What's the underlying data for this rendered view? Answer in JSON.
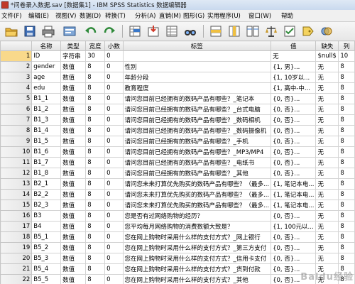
{
  "window": {
    "title": "*问卷录入数据.sav [数据集1] - IBM SPSS Statistics 数据编辑器"
  },
  "menu": [
    "文件(F)",
    "编辑(E)",
    "视图(V)",
    "数据(D)",
    "转换(T)",
    "分析(A)",
    "直销(M)",
    "图形(G)",
    "实用程序(U)",
    "窗口(W)",
    "帮助"
  ],
  "toolbar": {
    "icons": [
      "open-folder-icon",
      "save-icon",
      "print-icon",
      "dialog-recall-icon",
      "undo-icon",
      "redo-icon",
      "goto-case-icon",
      "goto-variable-icon",
      "variables-icon",
      "find-icon",
      "insert-cases-icon",
      "insert-variable-icon",
      "split-file-icon",
      "weight-cases-icon",
      "select-cases-icon",
      "value-labels-icon",
      "use-sets-icon"
    ]
  },
  "grid": {
    "headers": [
      "",
      "名称",
      "类型",
      "宽度",
      "小数",
      "标签",
      "值",
      "缺失",
      "列"
    ],
    "rows": [
      {
        "n": "1",
        "name": "ID",
        "type": "字符串",
        "width": "30",
        "dec": "0",
        "label": "",
        "values": "无",
        "missing": "$null$",
        "cols": "10"
      },
      {
        "n": "2",
        "name": "gender",
        "type": "数值",
        "width": "8",
        "dec": "0",
        "label": "性别",
        "values": "{1, 男}...",
        "missing": "无",
        "cols": "8"
      },
      {
        "n": "3",
        "name": "age",
        "type": "数值",
        "width": "8",
        "dec": "0",
        "label": "年龄分段",
        "values": "{1, 10岁以...",
        "missing": "无",
        "cols": "8"
      },
      {
        "n": "4",
        "name": "edu",
        "type": "数值",
        "width": "8",
        "dec": "0",
        "label": "教育程度",
        "values": "{1, 高中-中...",
        "missing": "无",
        "cols": "8"
      },
      {
        "n": "5",
        "name": "B1_1",
        "type": "数值",
        "width": "8",
        "dec": "0",
        "label": "请问您目前已经拥有的数码产品有哪些？_笔记本",
        "values": "{0, 否}...",
        "missing": "无",
        "cols": "8"
      },
      {
        "n": "6",
        "name": "B1_2",
        "type": "数值",
        "width": "8",
        "dec": "0",
        "label": "请问您目前已经拥有的数码产品有哪些？_台式电脑",
        "values": "{0, 否}...",
        "missing": "无",
        "cols": "8"
      },
      {
        "n": "7",
        "name": "B1_3",
        "type": "数值",
        "width": "8",
        "dec": "0",
        "label": "请问您目前已经拥有的数码产品有哪些？_数码相机",
        "values": "{0, 否}...",
        "missing": "无",
        "cols": "8"
      },
      {
        "n": "8",
        "name": "B1_4",
        "type": "数值",
        "width": "8",
        "dec": "0",
        "label": "请问您目前已经拥有的数码产品有哪些？_数码摄像机",
        "values": "{0, 否}...",
        "missing": "无",
        "cols": "8"
      },
      {
        "n": "9",
        "name": "B1_5",
        "type": "数值",
        "width": "8",
        "dec": "0",
        "label": "请问您目前已经拥有的数码产品有哪些？_手机",
        "values": "{0, 否}...",
        "missing": "无",
        "cols": "8"
      },
      {
        "n": "10",
        "name": "B1_6",
        "type": "数值",
        "width": "8",
        "dec": "0",
        "label": "请问您目前已经拥有的数码产品有哪些？_MP3/MP4",
        "values": "{0, 否}...",
        "missing": "无",
        "cols": "8"
      },
      {
        "n": "11",
        "name": "B1_7",
        "type": "数值",
        "width": "8",
        "dec": "0",
        "label": "请问您目前已经拥有的数码产品有哪些？_电纸书",
        "values": "{0, 否}...",
        "missing": "无",
        "cols": "8"
      },
      {
        "n": "12",
        "name": "B1_8",
        "type": "数值",
        "width": "8",
        "dec": "0",
        "label": "请问您目前已经拥有的数码产品有哪些？_其他",
        "values": "{0, 否}...",
        "missing": "无",
        "cols": "8"
      },
      {
        "n": "13",
        "name": "B2_1",
        "type": "数值",
        "width": "8",
        "dec": "0",
        "label": "请问您未来打算优先购买的数码产品有哪些？（最多...",
        "values": "{1, 笔记本电...",
        "missing": "无",
        "cols": "8"
      },
      {
        "n": "14",
        "name": "B2_2",
        "type": "数值",
        "width": "8",
        "dec": "0",
        "label": "请问您未来打算优先购买的数码产品有哪些？（最多...",
        "values": "{1, 笔记本电...",
        "missing": "无",
        "cols": "8"
      },
      {
        "n": "15",
        "name": "B2_3",
        "type": "数值",
        "width": "8",
        "dec": "0",
        "label": "请问您未来打算优先购买的数码产品有哪些？（最多...",
        "values": "{1, 笔记本电...",
        "missing": "无",
        "cols": "8"
      },
      {
        "n": "16",
        "name": "B3",
        "type": "数值",
        "width": "8",
        "dec": "0",
        "label": "您是否有过网络购物的经历？",
        "values": "{0, 否}...",
        "missing": "无",
        "cols": "8"
      },
      {
        "n": "17",
        "name": "B4",
        "type": "数值",
        "width": "8",
        "dec": "0",
        "label": "您平均每月网络购物的消费数额大致是？",
        "values": "{1, 100元以...",
        "missing": "无",
        "cols": "8"
      },
      {
        "n": "18",
        "name": "B5_1",
        "type": "数值",
        "width": "8",
        "dec": "0",
        "label": "您在网上购物时采用什么样的支付方式？_网上银行",
        "values": "{0, 否}...",
        "missing": "无",
        "cols": "8"
      },
      {
        "n": "19",
        "name": "B5_2",
        "type": "数值",
        "width": "8",
        "dec": "0",
        "label": "您在网上购物时采用什么样的支付方式？_第三方支付",
        "values": "{0, 否}...",
        "missing": "无",
        "cols": "8"
      },
      {
        "n": "20",
        "name": "B5_3",
        "type": "数值",
        "width": "8",
        "dec": "0",
        "label": "您在网上购物时采用什么样的支付方式？_信用卡支付",
        "values": "{0, 否}...",
        "missing": "无",
        "cols": "8"
      },
      {
        "n": "21",
        "name": "B5_4",
        "type": "数值",
        "width": "8",
        "dec": "0",
        "label": "您在网上购物时采用什么样的支付方式？_货到付款",
        "values": "{0, 否}...",
        "missing": "无",
        "cols": "8"
      },
      {
        "n": "22",
        "name": "B5_5",
        "type": "数值",
        "width": "8",
        "dec": "0",
        "label": "您在网上购物时采用什么样的支付方式？_其他",
        "values": "{0, 否}...",
        "missing": "无",
        "cols": "8"
      }
    ]
  },
  "watermark": {
    "text": "Baidu经验"
  }
}
